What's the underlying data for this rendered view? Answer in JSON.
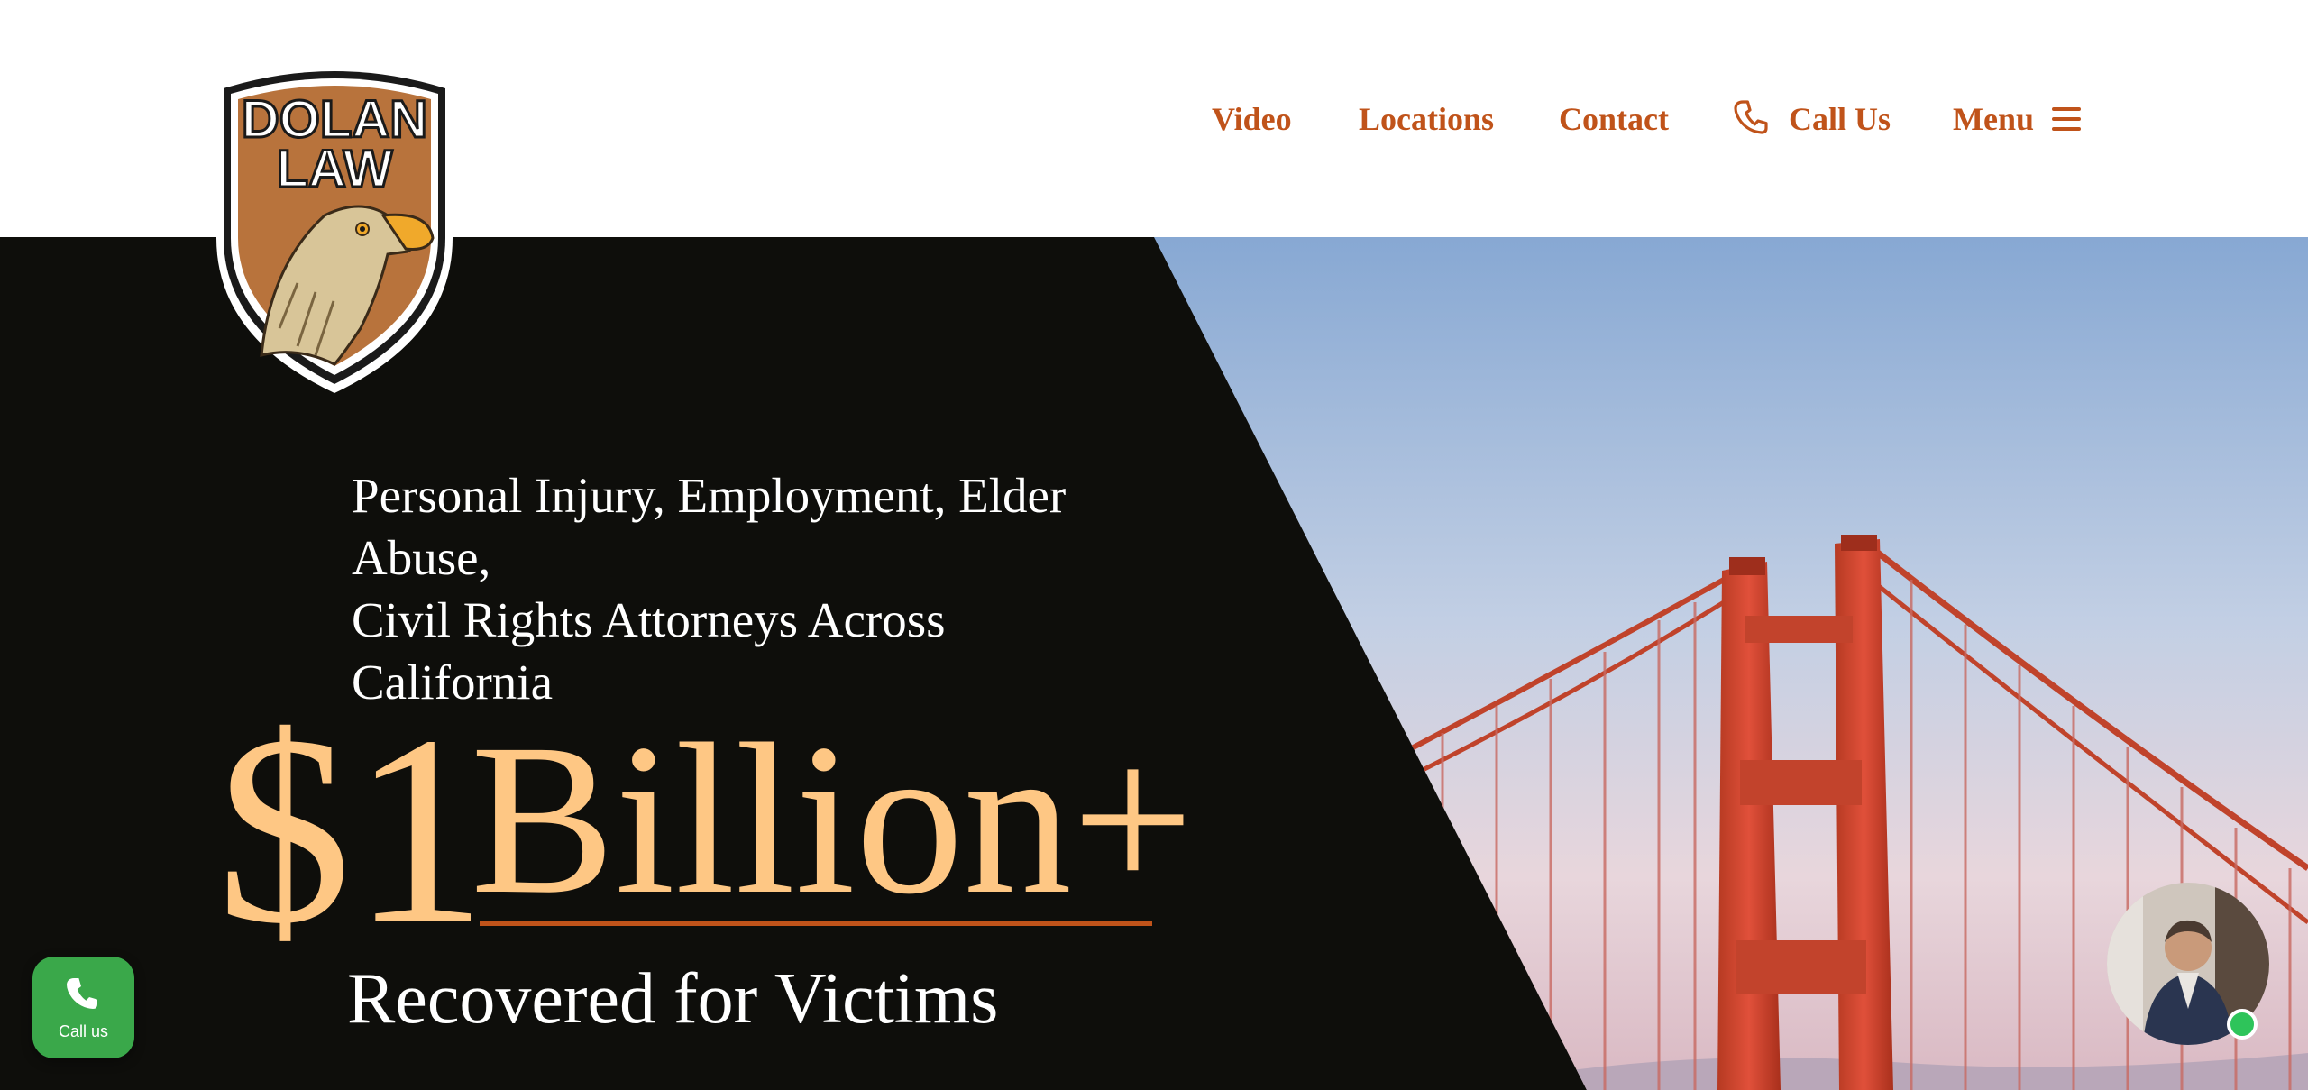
{
  "brand": {
    "logo_text_line1": "DOLAN",
    "logo_text_line2": "LAW",
    "accent_color": "#c0531a",
    "gold_color": "#fec784"
  },
  "nav": {
    "video": "Video",
    "locations": "Locations",
    "contact": "Contact",
    "call_us": "Call Us",
    "menu": "Menu",
    "phone_icon": "phone-icon",
    "menu_icon": "hamburger-icon"
  },
  "hero": {
    "tagline_line1": "Personal Injury, Employment, Elder",
    "tagline_line2": "Abuse,",
    "tagline_line3": "Civil Rights Attorneys Across",
    "tagline_line4": "California",
    "amount_prefix": "$1",
    "amount_word": "Billion+",
    "subline": "Recovered for Victims"
  },
  "floating": {
    "call_label": "Call us",
    "call_icon": "phone-icon",
    "chat_status": "online"
  }
}
